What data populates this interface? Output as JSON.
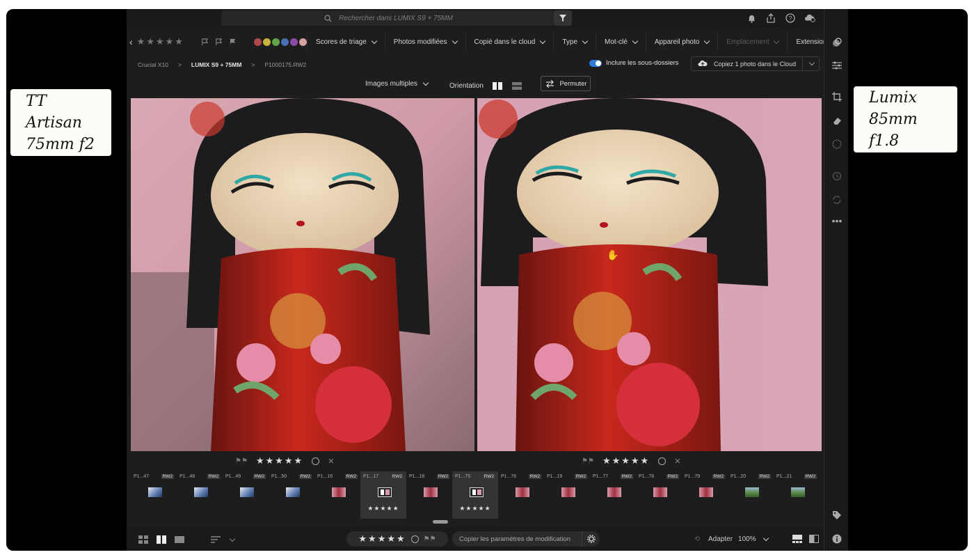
{
  "captions": {
    "left": {
      "line1": "TT Artisan",
      "line2": "75mm f2"
    },
    "right": {
      "line1": "Lumix",
      "line2": "85mm f1.8"
    }
  },
  "topbar": {
    "search_placeholder": "Rechercher dans LUMIX S9 + 75MM",
    "icons": [
      "search-icon",
      "filter-icon",
      "bell-icon",
      "share-icon",
      "help-icon",
      "cloud-sync-icon"
    ]
  },
  "filterbar": {
    "stars": "★★★★★",
    "label_colors": [
      "#b04848",
      "#c9b33a",
      "#5ea54a",
      "#4a6fb5",
      "#8a4ca8",
      "#d8a0a0"
    ],
    "dropdowns": [
      {
        "label": "Scores de triage"
      },
      {
        "label": "Photos modifiées"
      },
      {
        "label": "Copié dans le cloud"
      },
      {
        "label": "Type"
      },
      {
        "label": "Mot-clé"
      },
      {
        "label": "Appareil photo"
      },
      {
        "label": "Emplacement"
      },
      {
        "label": "Extension"
      }
    ]
  },
  "breadcrumb": {
    "items": [
      "Crucial X10",
      "LUMIX S9 + 75MM",
      "P1000175.RW2"
    ],
    "sep": ">"
  },
  "subfolders": {
    "label": "Inclure les sous-dossiers",
    "enabled": true
  },
  "cloud_copy": {
    "label": "Copiez 1 photo dans le Cloud"
  },
  "view": {
    "multi_label": "Images multiples",
    "orientation_label": "Orientation",
    "swap_label": "Permuter"
  },
  "left_rating": {
    "stars": "★★★★★"
  },
  "right_rating": {
    "stars": "★★★★★"
  },
  "filmstrip": [
    {
      "name": "P1...47",
      "ext": "RW2",
      "thumb": "landscape"
    },
    {
      "name": "P1...48",
      "ext": "RW2",
      "thumb": "landscape"
    },
    {
      "name": "P1...49",
      "ext": "RW2",
      "thumb": "landscape"
    },
    {
      "name": "P1...50",
      "ext": "RW2",
      "thumb": "landscape"
    },
    {
      "name": "P1...16",
      "ext": "RW2",
      "thumb": "pink"
    },
    {
      "name": "P1...17",
      "ext": "RW2",
      "thumb": "selected",
      "stars": "★★★★★",
      "selected": true
    },
    {
      "name": "P1...18",
      "ext": "RW2",
      "thumb": "pink"
    },
    {
      "name": "P1...75",
      "ext": "RW2",
      "thumb": "selected",
      "stars": "★★★★★",
      "selected": true
    },
    {
      "name": "P1...76",
      "ext": "RW2",
      "thumb": "pink"
    },
    {
      "name": "P1...19",
      "ext": "RW2",
      "thumb": "pink"
    },
    {
      "name": "P1...77",
      "ext": "RW2",
      "thumb": "pink"
    },
    {
      "name": "P1...78",
      "ext": "RW2",
      "thumb": "pink"
    },
    {
      "name": "P1...79",
      "ext": "RW2",
      "thumb": "pink"
    },
    {
      "name": "P1...20",
      "ext": "RW2",
      "thumb": "green"
    },
    {
      "name": "P1...21",
      "ext": "RW2",
      "thumb": "green"
    }
  ],
  "bottombar": {
    "stars": "★★★★★",
    "copy_settings": "Copier les paramètres de modification",
    "fit_label": "Adapter",
    "zoom": "100%"
  },
  "rightbar_icons": [
    "edit-icon",
    "sliders-icon",
    "crop-icon",
    "eraser-icon",
    "masking-icon",
    "history-icon",
    "versions-icon",
    "more-icon",
    "tag-icon",
    "info-icon"
  ]
}
